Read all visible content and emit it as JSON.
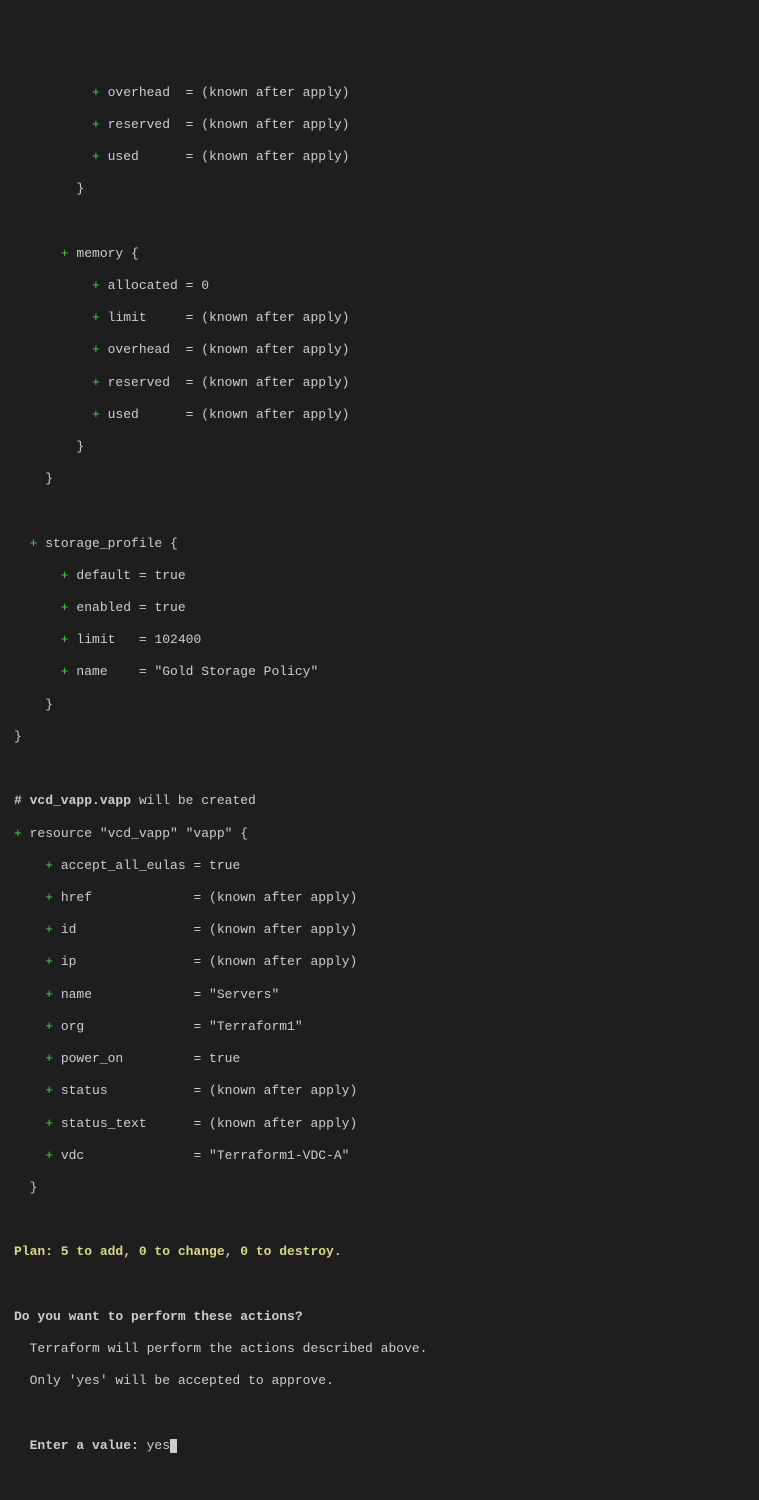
{
  "block1": {
    "l1": {
      "p": "          + ",
      "k": "overhead  ",
      "e": "= ",
      "v": "(known after apply)"
    },
    "l2": {
      "p": "          + ",
      "k": "reserved  ",
      "e": "= ",
      "v": "(known after apply)"
    },
    "l3": {
      "p": "          + ",
      "k": "used      ",
      "e": "= ",
      "v": "(known after apply)"
    },
    "close": "        }"
  },
  "memory": {
    "open": {
      "p": "      + ",
      "t": "memory {"
    },
    "l1": {
      "p": "          + ",
      "k": "allocated ",
      "e": "= ",
      "v": "0"
    },
    "l2": {
      "p": "          + ",
      "k": "limit     ",
      "e": "= ",
      "v": "(known after apply)"
    },
    "l3": {
      "p": "          + ",
      "k": "overhead  ",
      "e": "= ",
      "v": "(known after apply)"
    },
    "l4": {
      "p": "          + ",
      "k": "reserved  ",
      "e": "= ",
      "v": "(known after apply)"
    },
    "l5": {
      "p": "          + ",
      "k": "used      ",
      "e": "= ",
      "v": "(known after apply)"
    },
    "close": "        }",
    "close2": "    }"
  },
  "storage": {
    "open": {
      "p": "  + ",
      "t": "storage_profile {"
    },
    "l1": {
      "p": "      + ",
      "k": "default ",
      "e": "= ",
      "v": "true"
    },
    "l2": {
      "p": "      + ",
      "k": "enabled ",
      "e": "= ",
      "v": "true"
    },
    "l3": {
      "p": "      + ",
      "k": "limit   ",
      "e": "= ",
      "v": "102400"
    },
    "l4": {
      "p": "      + ",
      "k": "name    ",
      "e": "= ",
      "v": "\"Gold Storage Policy\""
    },
    "close": "    }",
    "close2": "}"
  },
  "vapp": {
    "comment": {
      "h": "# vcd_vapp.vapp",
      "t": " will be created"
    },
    "open": {
      "p": "+ ",
      "t": "resource \"vcd_vapp\" \"vapp\" {"
    },
    "l1": {
      "p": "    + ",
      "k": "accept_all_eulas ",
      "e": "= ",
      "v": "true"
    },
    "l2": {
      "p": "    + ",
      "k": "href             ",
      "e": "= ",
      "v": "(known after apply)"
    },
    "l3": {
      "p": "    + ",
      "k": "id               ",
      "e": "= ",
      "v": "(known after apply)"
    },
    "l4": {
      "p": "    + ",
      "k": "ip               ",
      "e": "= ",
      "v": "(known after apply)"
    },
    "l5": {
      "p": "    + ",
      "k": "name             ",
      "e": "= ",
      "v": "\"Servers\""
    },
    "l6": {
      "p": "    + ",
      "k": "org              ",
      "e": "= ",
      "v": "\"Terraform1\""
    },
    "l7": {
      "p": "    + ",
      "k": "power_on         ",
      "e": "= ",
      "v": "true"
    },
    "l8": {
      "p": "    + ",
      "k": "status           ",
      "e": "= ",
      "v": "(known after apply)"
    },
    "l9": {
      "p": "    + ",
      "k": "status_text      ",
      "e": "= ",
      "v": "(known after apply)"
    },
    "l10": {
      "p": "    + ",
      "k": "vdc              ",
      "e": "= ",
      "v": "\"Terraform1-VDC-A\""
    },
    "close": "  }"
  },
  "plan": "Plan: 5 to add, 0 to change, 0 to destroy.",
  "prompt": {
    "q": "Do you want to perform these actions?",
    "d1": "  Terraform will perform the actions described above.",
    "d2": "  Only 'yes' will be accepted to approve.",
    "label": "  Enter a value: ",
    "input": "yes"
  }
}
